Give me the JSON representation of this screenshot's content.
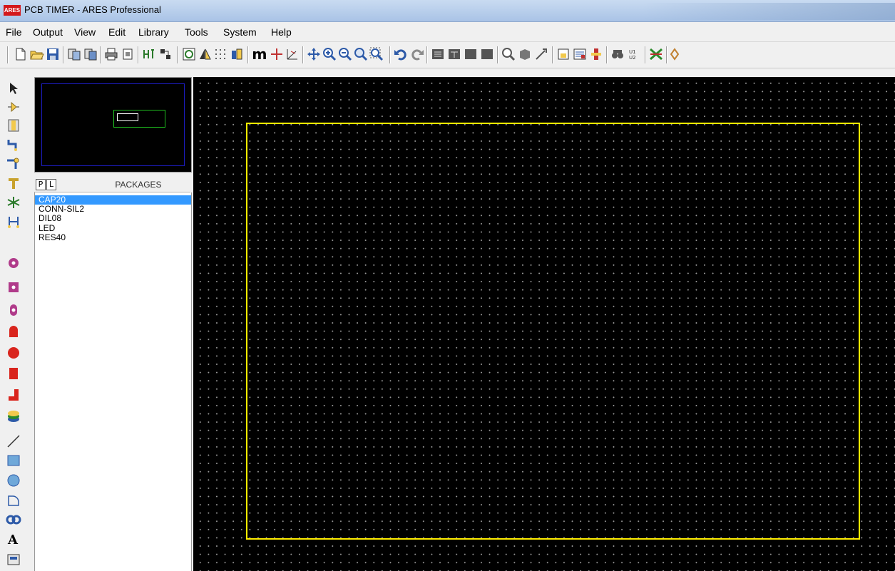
{
  "window": {
    "title": "PCB TIMER - ARES Professional",
    "logo_text": "ARES"
  },
  "menu": [
    "File",
    "Output",
    "View",
    "Edit",
    "Library",
    "Tools",
    "System",
    "Help"
  ],
  "toolbar_icons": [
    "new-file-icon",
    "open-folder-icon",
    "save-icon",
    "import-icon",
    "export-icon",
    "print-icon",
    "print-area-icon",
    "component-mode-icon",
    "netlist-icon",
    "refresh-icon",
    "flip-icon",
    "grid-icon",
    "layers-icon",
    "metric-icon",
    "origin-icon",
    "coordinates-icon",
    "pan-icon",
    "zoom-in-icon",
    "zoom-out-icon",
    "zoom-all-icon",
    "zoom-area-icon",
    "undo-icon",
    "redo-icon",
    "block-copy-icon",
    "block-move-icon",
    "block-rotate-icon",
    "block-delete-icon",
    "pick-icon",
    "make-package-icon",
    "decompose-icon",
    "design-rule-icon",
    "connectivity-icon",
    "autoroute-icon",
    "search-icon",
    "toggle-icon",
    "ratsnest-icon",
    "autoplacer-icon"
  ],
  "left_tools": [
    "selection-icon",
    "component-icon",
    "package-icon",
    "track-icon",
    "via-icon",
    "zone-icon",
    "ratsnest-icon",
    "connectivity-icon",
    "round-pad-icon",
    "square-pad-icon",
    "dil-pad-icon",
    "edge-pad-icon",
    "circle-smd-icon",
    "rect-smd-icon",
    "polygonal-pad-icon",
    "padstack-icon",
    "line-icon",
    "box-icon",
    "circle-icon",
    "arc-icon",
    "path-icon",
    "text-icon",
    "symbol-icon"
  ],
  "packages": {
    "header": "PACKAGES",
    "tab_p": "P",
    "tab_l": "L",
    "selected": "CAP20",
    "items": [
      "CAP20",
      "CONN-SIL2",
      "DIL08",
      "LED",
      "RES40"
    ]
  },
  "colors": {
    "canvas_bg": "#000000",
    "grid_dot": "#9a9a9a",
    "board_outline": "#ffee00",
    "overview_board": "#1c1cbf",
    "overview_window": "#1fbe1f",
    "selection": "#3399ff"
  }
}
